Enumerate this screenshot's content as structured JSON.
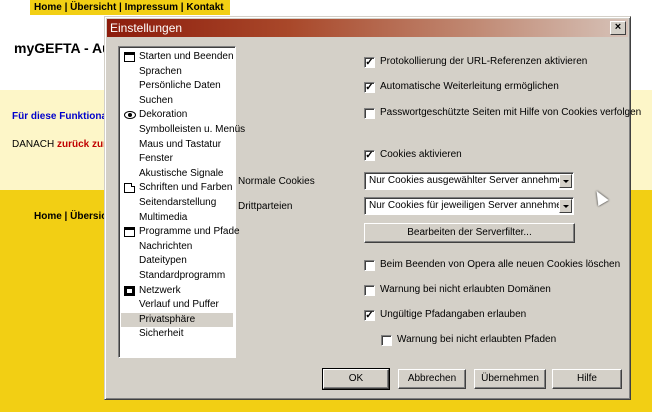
{
  "page": {
    "nav_items": [
      "Home",
      "Übersicht",
      "Impressum",
      "Kontakt"
    ],
    "nav_sep": " | ",
    "site_title": "myGEFTA - Au",
    "func_text": "Für diese Funktiona",
    "danach_prefix": "DANACH ",
    "danach_link": "zurück zum",
    "lower_nav": "Home | Übersic"
  },
  "dialog": {
    "title": "Einstellungen",
    "close_glyph": "×",
    "categories": [
      {
        "label": "Starten und Beenden",
        "icon": "window-icon"
      },
      {
        "label": "Sprachen",
        "icon": ""
      },
      {
        "label": "Persönliche Daten",
        "icon": ""
      },
      {
        "label": "Suchen",
        "icon": ""
      },
      {
        "label": "Dekoration",
        "icon": "eye-icon"
      },
      {
        "label": "Symbolleisten u. Menüs",
        "icon": ""
      },
      {
        "label": "Maus und Tastatur",
        "icon": ""
      },
      {
        "label": "Fenster",
        "icon": ""
      },
      {
        "label": "Akustische Signale",
        "icon": ""
      },
      {
        "label": "Schriften und Farben",
        "icon": "document-icon"
      },
      {
        "label": "Seitendarstellung",
        "icon": ""
      },
      {
        "label": "Multimedia",
        "icon": ""
      },
      {
        "label": "Programme und Pfade",
        "icon": "window-icon"
      },
      {
        "label": "Nachrichten",
        "icon": ""
      },
      {
        "label": "Dateitypen",
        "icon": ""
      },
      {
        "label": "Standardprogramm",
        "icon": ""
      },
      {
        "label": "Netzwerk",
        "icon": "network-icon"
      },
      {
        "label": "Verlauf und Puffer",
        "icon": ""
      },
      {
        "label": "Privatsphäre",
        "icon": "",
        "selected": true
      },
      {
        "label": "Sicherheit",
        "icon": ""
      }
    ],
    "options": {
      "url_logging": {
        "label": "Protokollierung der URL-Referenzen aktivieren",
        "checked": true
      },
      "auto_redirect": {
        "label": "Automatische Weiterleitung ermöglichen",
        "checked": true
      },
      "pw_cookies": {
        "label": "Passwortgeschützte Seiten mit Hilfe von Cookies verfolgen",
        "checked": false
      },
      "cookies_enabled": {
        "label": "Cookies aktivieren",
        "checked": true
      },
      "delete_on_exit": {
        "label": "Beim Beenden von Opera alle neuen Cookies löschen",
        "checked": false
      },
      "warn_domains": {
        "label": "Warnung bei nicht erlaubten Domänen",
        "checked": false
      },
      "invalid_paths": {
        "label": "Ungültige Pfadangaben erlauben",
        "checked": true
      },
      "warn_paths": {
        "label": "Warnung bei nicht erlaubten Pfaden",
        "checked": false
      }
    },
    "check_glyph": "✓",
    "normal_cookies_label": "Normale Cookies",
    "normal_cookies_value": "Nur Cookies ausgewählter Server annehmen",
    "third_party_label": "Drittparteien",
    "third_party_value": "Nur Cookies für jeweiligen Server annehmen",
    "server_filter_button": "Bearbeiten der Serverfilter...",
    "buttons": {
      "ok": "OK",
      "cancel": "Abbrechen",
      "apply": "Übernehmen",
      "help": "Hilfe"
    }
  }
}
